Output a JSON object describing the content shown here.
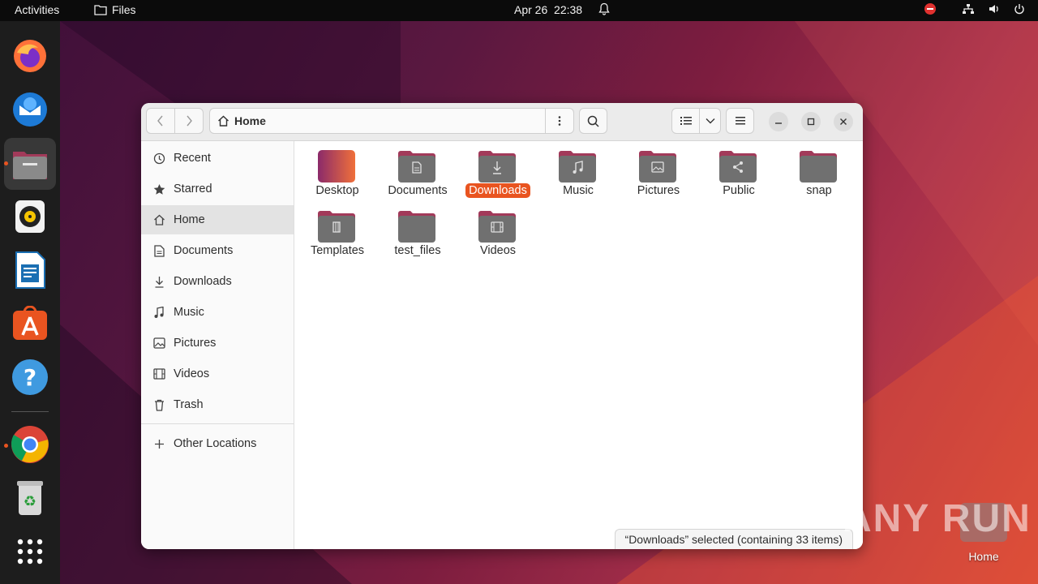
{
  "topbar": {
    "activities": "Activities",
    "app_name": "Files",
    "date": "Apr 26",
    "time": "22:38"
  },
  "dock": {
    "apps": [
      "firefox-icon",
      "thunderbird-icon",
      "files-icon",
      "rhythmbox-icon",
      "writer-icon",
      "software-icon",
      "help-icon",
      "chrome-icon",
      "trash-icon",
      "app-grid-icon"
    ]
  },
  "window": {
    "location": "Home",
    "sidebar": [
      {
        "label": "Recent",
        "icon": "clock-icon"
      },
      {
        "label": "Starred",
        "icon": "star-icon"
      },
      {
        "label": "Home",
        "icon": "home-icon",
        "selected": true
      },
      {
        "label": "Documents",
        "icon": "document-icon"
      },
      {
        "label": "Downloads",
        "icon": "download-icon"
      },
      {
        "label": "Music",
        "icon": "music-icon"
      },
      {
        "label": "Pictures",
        "icon": "picture-icon"
      },
      {
        "label": "Videos",
        "icon": "video-icon"
      },
      {
        "label": "Trash",
        "icon": "trash-icon"
      }
    ],
    "other_locations": "Other Locations",
    "folders": [
      {
        "label": "Desktop",
        "glyph": ""
      },
      {
        "label": "Documents",
        "glyph": "doc"
      },
      {
        "label": "Downloads",
        "glyph": "down",
        "selected": true
      },
      {
        "label": "Music",
        "glyph": "note"
      },
      {
        "label": "Pictures",
        "glyph": "pic"
      },
      {
        "label": "Public",
        "glyph": "share"
      },
      {
        "label": "snap",
        "glyph": ""
      },
      {
        "label": "Templates",
        "glyph": "tpl"
      },
      {
        "label": "test_files",
        "glyph": ""
      },
      {
        "label": "Videos",
        "glyph": "film"
      }
    ],
    "status": "“Downloads” selected  (containing 33 items)"
  },
  "desktop": {
    "home_label": "Home",
    "watermark": "ANY RUN"
  },
  "colors": {
    "accent": "#e95420",
    "folder_top": "#a23a5a",
    "folder_body": "#707070"
  }
}
